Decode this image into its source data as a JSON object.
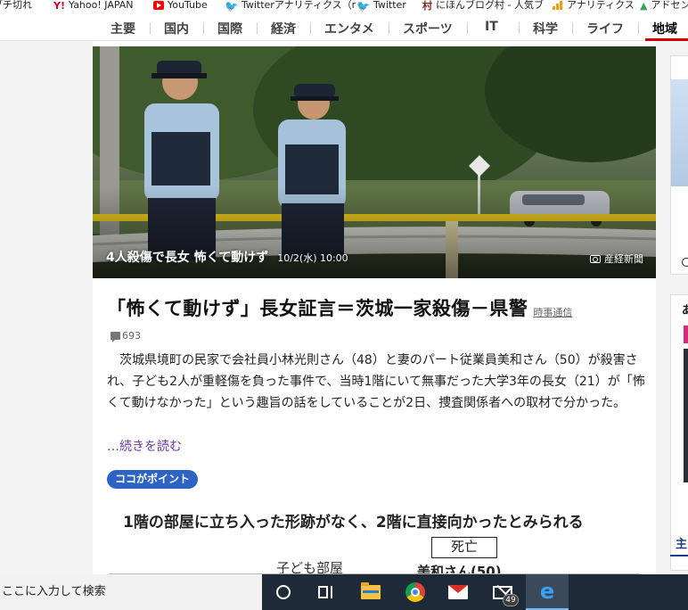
{
  "bookmarks": [
    {
      "label": "ブチ切れ",
      "icon": "page-icon"
    },
    {
      "label": "Yahoo! JAPAN",
      "icon": "yahoo-icon"
    },
    {
      "label": "YouTube",
      "icon": "youtube-icon"
    },
    {
      "label": "Twitterアナリティクス（r",
      "icon": "twitter-icon"
    },
    {
      "label": "Twitter",
      "icon": "twitter-icon"
    },
    {
      "label": "にほんブログ村 - 人気ブ",
      "icon": "nihon-blog-mura-icon"
    },
    {
      "label": "アナリティクス",
      "icon": "analytics-icon"
    },
    {
      "label": "アドセン",
      "icon": "adsense-icon"
    }
  ],
  "categories": [
    {
      "label": "主要"
    },
    {
      "label": "国内"
    },
    {
      "label": "国際"
    },
    {
      "label": "経済"
    },
    {
      "label": "エンタメ"
    },
    {
      "label": "スポーツ"
    },
    {
      "label": "IT"
    },
    {
      "label": "科学"
    },
    {
      "label": "ライフ"
    },
    {
      "label": "地域",
      "active": true
    }
  ],
  "hero": {
    "caption_title": "4人殺傷で長女 怖くて動けず",
    "caption_date": "10/2(水) 10:00",
    "credit": "産経新聞"
  },
  "article": {
    "headline": "「怖くて動けず」長女証言＝茨城一家殺傷－県警",
    "source": "時事通信",
    "comment_count": "693",
    "body": "茨城県境町の民家で会社員小林光則さん（48）と妻のパート従業員美和さん（50）が殺害され、子ども2人が重軽傷を負った事件で、当時1階にいて無事だった大学3年の長女（21）が「怖くて動けなかった」という趣旨の話をしていることが2日、捜査関係者への取材で分かった。",
    "read_more": "…続きを読む",
    "point_badge": "ココがポイント"
  },
  "diagram": {
    "title": "1階の部屋に立ち入った形跡がなく、2階に直接向かったとみられる",
    "death_label": "死亡",
    "child_room_label": "子ども部屋",
    "victim_label": "美和さん(50)"
  },
  "sidebar": {
    "card2_initial": "あ",
    "footer_heading_initial": "主"
  },
  "taskbar": {
    "search_placeholder": "ここに入力して検索",
    "mail_badge": "49"
  },
  "colors": {
    "accent_red": "#d10000",
    "link_purple": "#6a3aa8",
    "badge_blue": "#2c63c5",
    "taskbar": "#1e2a37"
  }
}
